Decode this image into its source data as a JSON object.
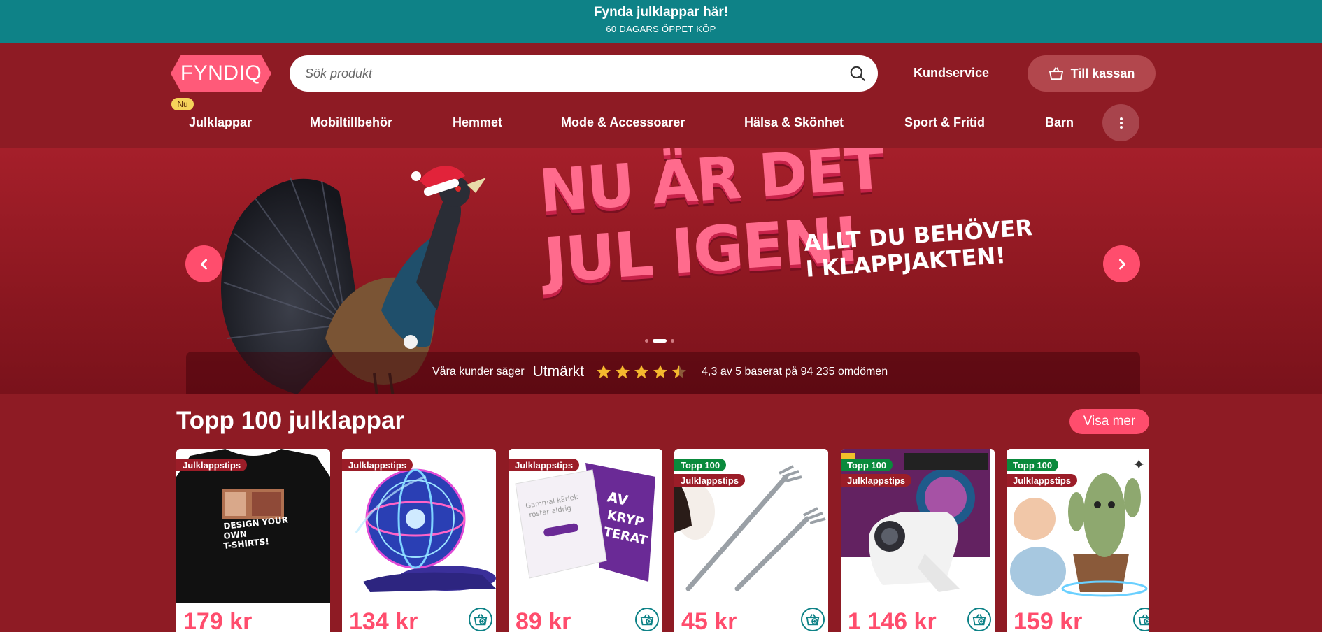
{
  "promo": {
    "title": "Fynda julklappar här!",
    "subtitle": "60 DAGARS ÖPPET KÖP"
  },
  "header": {
    "logo_text": "FYNDIQ",
    "new_badge": "Nu",
    "search_placeholder": "Sök produkt",
    "customer_service": "Kundservice",
    "checkout": "Till kassan"
  },
  "nav": {
    "items": [
      "Julklappar",
      "Mobiltillbehör",
      "Hemmet",
      "Mode & Accessoarer",
      "Hälsa & Skönhet",
      "Sport & Fritid",
      "Barn"
    ]
  },
  "hero": {
    "headline_line1": "NU ÄR DET",
    "headline_line2": "JUL IGEN!",
    "sub_line1": "ALLT DU BEHÖVER",
    "sub_line2": "I KLAPPJAKTEN!",
    "slide_count": 3,
    "active_slide": 2
  },
  "rating": {
    "prefix": "Våra kunder säger",
    "word": "Utmärkt",
    "stars": 4.5,
    "text": "4,3 av 5 baserat på 94 235 omdömen"
  },
  "section": {
    "title": "Topp 100 julklappar",
    "more": "Visa mer"
  },
  "products": [
    {
      "tags": [
        "Julklappstips"
      ],
      "price": "179 kr",
      "image": "custom-tshirt"
    },
    {
      "tags": [
        "Julklappstips"
      ],
      "price": "134 kr",
      "image": "flying-orb-ball"
    },
    {
      "tags": [
        "Julklappstips"
      ],
      "price": "89 kr",
      "image": "card-game"
    },
    {
      "tags": [
        "Topp 100",
        "Julklappstips"
      ],
      "price": "45 kr",
      "image": "back-scratcher"
    },
    {
      "tags": [
        "Topp 100",
        "Julklappstips"
      ],
      "price": "1 146 kr",
      "image": "mini-projector"
    },
    {
      "tags": [
        "Topp 100",
        "Julklappstips"
      ],
      "price": "159 kr",
      "image": "dancing-cactus"
    }
  ],
  "colors": {
    "promo_bg": "#0e8287",
    "header_bg": "#8e1b24",
    "accent": "#ff4d6d",
    "tag_red": "#9b1d28",
    "tag_green": "#0a8a3c",
    "star": "#f5b82e"
  }
}
